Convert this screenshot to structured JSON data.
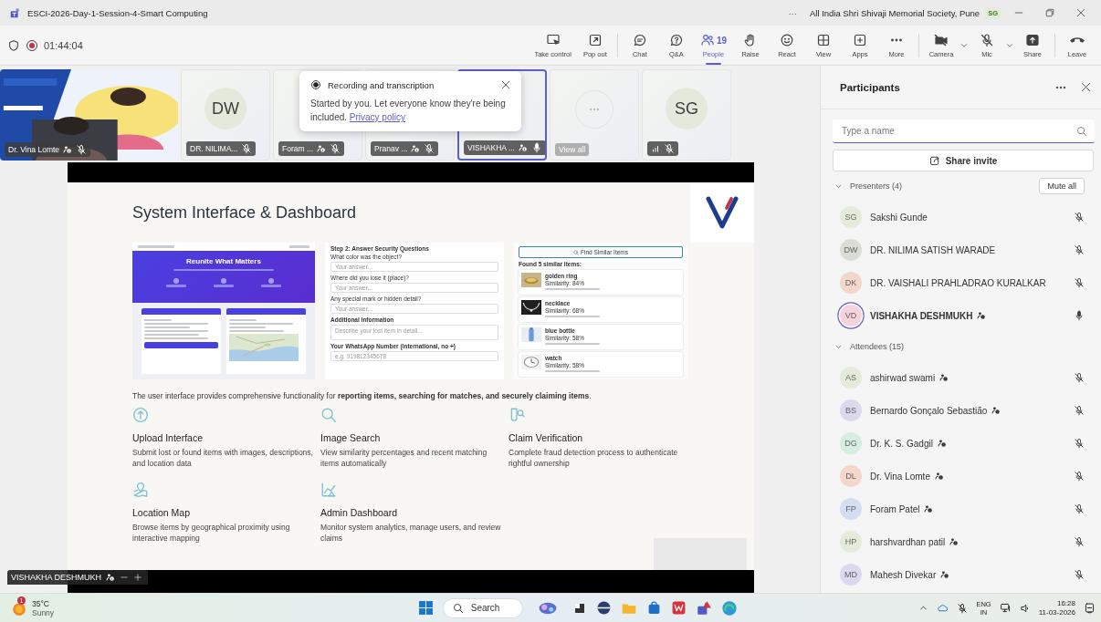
{
  "window": {
    "title": "ESCI-2026-Day-1-Session-4-Smart Computing",
    "more": "···",
    "organization": "All India Shri Shivaji Memorial Society, Pune",
    "account": "SG"
  },
  "meeting": {
    "recording": true,
    "elapsed": "01:44:04"
  },
  "toolbar": [
    {
      "kind": "take-control",
      "label": "Take control",
      "selected": false,
      "dropdown": false,
      "divider_after": false
    },
    {
      "kind": "pop-out",
      "label": "Pop out",
      "selected": false,
      "dropdown": false,
      "divider_after": true
    },
    {
      "kind": "chat",
      "label": "Chat",
      "selected": false,
      "dropdown": false,
      "divider_after": false
    },
    {
      "kind": "qa",
      "label": "Q&A",
      "selected": false,
      "dropdown": false,
      "divider_after": false
    },
    {
      "kind": "people",
      "label": "People",
      "count": "19",
      "selected": true,
      "dropdown": false,
      "divider_after": false
    },
    {
      "kind": "raise",
      "label": "Raise",
      "selected": false,
      "dropdown": false,
      "divider_after": false
    },
    {
      "kind": "react",
      "label": "React",
      "selected": false,
      "dropdown": false,
      "divider_after": false
    },
    {
      "kind": "view",
      "label": "View",
      "selected": false,
      "dropdown": false,
      "divider_after": false
    },
    {
      "kind": "apps",
      "label": "Apps",
      "selected": false,
      "dropdown": false,
      "divider_after": false
    },
    {
      "kind": "more",
      "label": "More",
      "selected": false,
      "dropdown": false,
      "divider_after": true
    },
    {
      "kind": "camera",
      "label": "Camera",
      "selected": false,
      "dropdown": true,
      "divider_after": false
    },
    {
      "kind": "mic",
      "label": "Mic",
      "selected": false,
      "dropdown": true,
      "divider_after": false
    },
    {
      "kind": "share",
      "label": "Share",
      "selected": false,
      "dropdown": false,
      "divider_after": true
    },
    {
      "kind": "leave",
      "label": "Leave",
      "selected": false,
      "dropdown": false,
      "divider_after": false
    }
  ],
  "gallery": [
    {
      "kind": "video",
      "name": "Dr. Vina Lomte",
      "external": true,
      "muted": true
    },
    {
      "kind": "avatar",
      "initials": "DW",
      "name": "DR. NILIMA...",
      "external": false,
      "muted": true,
      "speaking": false
    },
    {
      "kind": "avatar",
      "name": "Foram ...",
      "external": true,
      "muted": true,
      "speaking": false
    },
    {
      "kind": "avatar",
      "name": "Pranav ...",
      "external": true,
      "muted": true,
      "speaking": false
    },
    {
      "kind": "avatar",
      "name": "VISHAKHA ...",
      "external": true,
      "muted": false,
      "speaking": true
    },
    {
      "kind": "overflow",
      "label": "View all"
    },
    {
      "kind": "avatar",
      "initials": "SG",
      "signal": true,
      "external": false,
      "muted": true,
      "speaking": false
    }
  ],
  "notification": {
    "title": "Recording and transcription",
    "message": "Started by you. Let everyone know they're being included.",
    "link": "Privacy policy"
  },
  "stage": {
    "slide": {
      "title": "System Interface & Dashboard",
      "screenshots": [
        {
          "kind": "home",
          "heading": "Reunite What Matters"
        },
        {
          "kind": "form",
          "step": "Step 2: Answer Security Questions",
          "fields": [
            {
              "label": "What color was the object?",
              "placeholder": "Your answer..."
            },
            {
              "label": "Where did you lose it (place)?",
              "placeholder": "Your answer..."
            },
            {
              "label": "Any special mark or hidden detail?",
              "placeholder": "Your answer..."
            }
          ],
          "section": "Additional Information",
          "details_placeholder": "Describe your lost item in detail...",
          "phone_label": "Your WhatsApp Number (international, no +)",
          "phone_placeholder": "e.g. 919812345678"
        },
        {
          "kind": "results",
          "search_button": "Find Similar Items",
          "found": "Found 5 similar items:",
          "results": [
            {
              "kind": "ring",
              "name": "golden ring",
              "similarity": "Similarity: 84%"
            },
            {
              "kind": "necklace",
              "name": "necklace",
              "similarity": "Similarity: 68%"
            },
            {
              "kind": "bottle",
              "name": "blue bottle",
              "similarity": "Similarity: 58%"
            },
            {
              "kind": "watch",
              "name": "watch",
              "similarity": "Similarity: 58%"
            }
          ]
        }
      ],
      "intro": "The user interface provides comprehensive functionality for **reporting items, searching for matches, and securely claiming items**.",
      "features": [
        {
          "kind": "upload",
          "title": "Upload Interface",
          "description": "Submit lost or found items with images, descriptions, and location data"
        },
        {
          "kind": "search",
          "title": "Image Search",
          "description": "View similarity percentages and recent matching items automatically"
        },
        {
          "kind": "verify",
          "title": "Claim Verification",
          "description": "Complete fraud detection process to authenticate rightful ownership"
        },
        {
          "kind": "map",
          "title": "Location Map",
          "description": "Browse items by geographical proximity using interactive mapping"
        },
        {
          "kind": "chart",
          "title": "Admin Dashboard",
          "description": "Monitor system analytics, manage users, and review claims"
        }
      ]
    },
    "presenter": {
      "name": "VISHAKHA DESHMUKH",
      "external": true
    }
  },
  "participants": {
    "title": "Participants",
    "search_placeholder": "Type a name",
    "share_label": "Share invite",
    "groups": [
      {
        "label": "Presenters (4)",
        "expanded": true,
        "action": "Mute all",
        "members": [
          {
            "initials": "SG",
            "name": "Sakshi Gunde",
            "color": "#e4ecd9",
            "external": false,
            "muted": true,
            "speaking": false
          },
          {
            "initials": "DW",
            "name": "DR. NILIMA SATISH WARADE",
            "color": "#d9ddd3",
            "external": false,
            "muted": true,
            "speaking": false
          },
          {
            "initials": "DK",
            "name": "DR. VAISHALI PRAHLADRAO KURALKAR",
            "color": "#f3d6cc",
            "external": false,
            "muted": true,
            "speaking": false
          },
          {
            "initials": "VD",
            "name": "VISHAKHA DESHMUKH",
            "color": "#f3d3dc",
            "external": true,
            "muted": false,
            "speaking": true
          }
        ]
      },
      {
        "label": "Attendees (15)",
        "expanded": true,
        "members": [
          {
            "initials": "AS",
            "name": "ashirwad swami",
            "color": "#e4ecd9",
            "external": true,
            "muted": true,
            "speaking": false
          },
          {
            "initials": "BS",
            "name": "Bernardo Gonçalo Sebastião",
            "color": "#dcd9ef",
            "external": true,
            "muted": true,
            "speaking": false
          },
          {
            "initials": "DG",
            "name": "Dr. K. S. Gadgil",
            "color": "#d6eddf",
            "external": true,
            "muted": true,
            "speaking": false
          },
          {
            "initials": "DL",
            "name": "Dr. Vina Lomte",
            "color": "#f3d6cc",
            "external": true,
            "muted": true,
            "speaking": false
          },
          {
            "initials": "FP",
            "name": "Foram Patel",
            "color": "#d4def0",
            "external": true,
            "muted": true,
            "speaking": false
          },
          {
            "initials": "HP",
            "name": "harshvardhan patil",
            "color": "#e4ecd9",
            "external": true,
            "muted": true,
            "speaking": false
          },
          {
            "initials": "MD",
            "name": "Mahesh Divekar",
            "color": "#dcd9ef",
            "external": true,
            "muted": true,
            "speaking": false
          }
        ]
      }
    ]
  },
  "taskbar": {
    "weather": {
      "alerts": "1",
      "temperature": "35°C",
      "condition": "Sunny"
    },
    "search_label": "Search",
    "language": "ENG",
    "region": "IN",
    "time": "16:28",
    "date": "11-03-2026"
  }
}
